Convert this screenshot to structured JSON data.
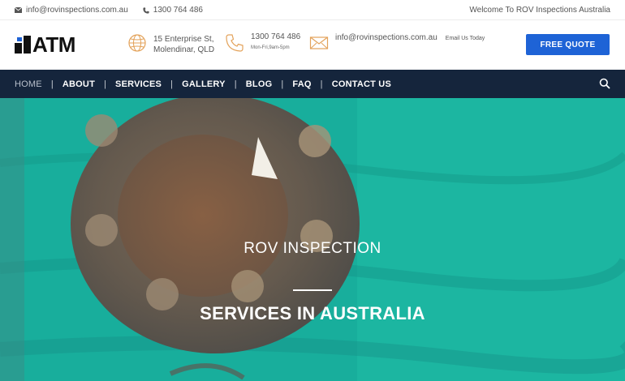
{
  "topbar": {
    "email": "info@rovinspections.com.au",
    "phone": "1300 764 486",
    "welcome": "Welcome To ROV Inspections Australia"
  },
  "header": {
    "logo_text": "ATM",
    "address_line1": "15 Enterprise St,",
    "address_line2": "Molendinar, QLD",
    "phone": "1300 764 486",
    "phone_hours": "Mon-Fri,9am-5pm",
    "email": "info@rovinspections.com.au",
    "email_label": "Email Us Today",
    "quote_button": "FREE QUOTE"
  },
  "nav": {
    "items": [
      "HOME",
      "ABOUT",
      "SERVICES",
      "GALLERY",
      "BLOG",
      "FAQ",
      "CONTACT US"
    ],
    "active": "HOME"
  },
  "hero": {
    "title": "ROV INSPECTION",
    "subtitle": "SERVICES IN AUSTRALIA"
  },
  "colors": {
    "accent": "#1e63d6",
    "nav_bg": "#15253c",
    "icon_orange": "#e3a25a",
    "hero_teal": "#1ab3a0"
  },
  "icons": [
    "envelope-icon",
    "phone-icon",
    "globe-icon",
    "search-icon"
  ]
}
